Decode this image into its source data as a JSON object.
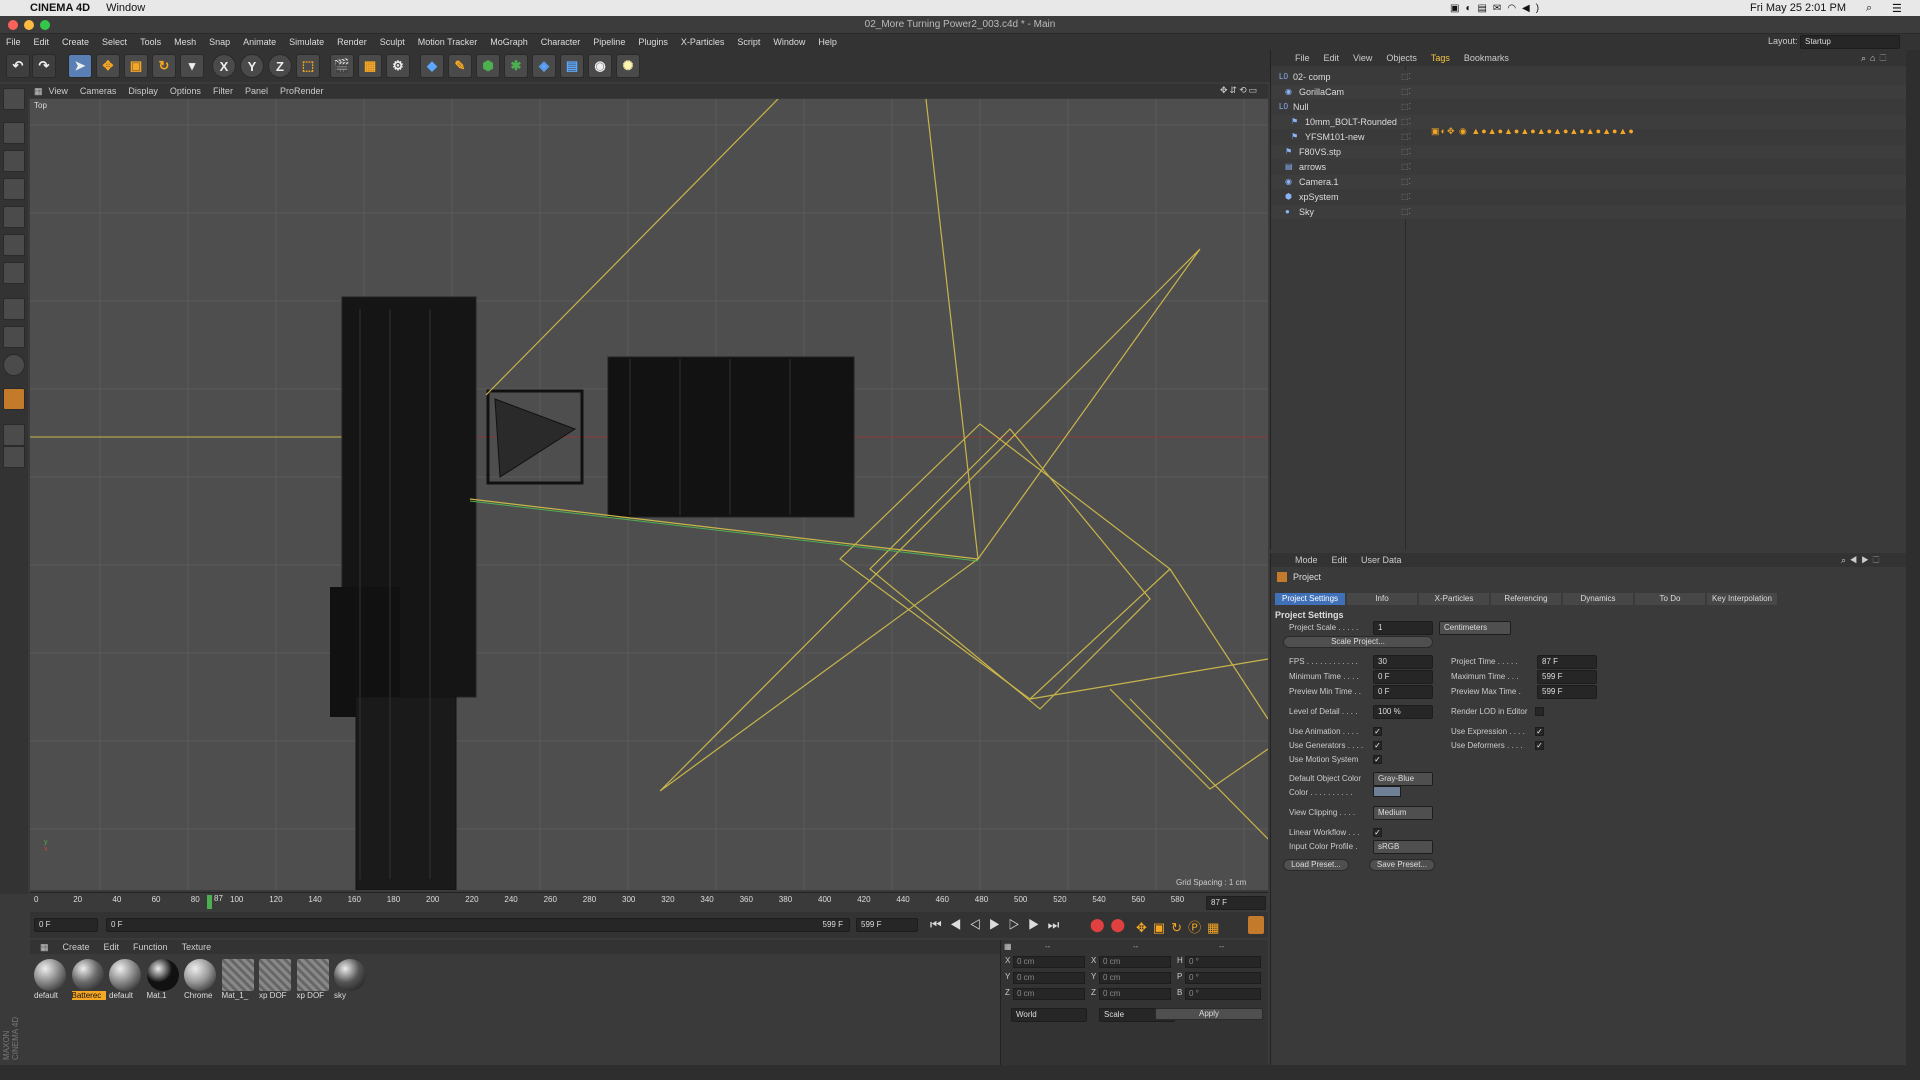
{
  "mac": {
    "app_name": "CINEMA 4D",
    "menu_window": "Window",
    "clock": "Fri May 25  2:01 PM"
  },
  "window": {
    "title": "02_More Turning Power2_003.c4d * - Main"
  },
  "menu": [
    "File",
    "Edit",
    "Create",
    "Select",
    "Tools",
    "Mesh",
    "Snap",
    "Animate",
    "Simulate",
    "Render",
    "Sculpt",
    "Motion Tracker",
    "MoGraph",
    "Character",
    "Pipeline",
    "Plugins",
    "X-Particles",
    "Script",
    "Window",
    "Help"
  ],
  "layout": {
    "label": "Layout:",
    "value": "Startup"
  },
  "toolbar": {
    "x": "X",
    "y": "Y",
    "z": "Z"
  },
  "viewport": {
    "menu": [
      "View",
      "Cameras",
      "Display",
      "Options",
      "Filter",
      "Panel",
      "ProRender"
    ],
    "name": "Top",
    "grid_spacing": "Grid Spacing : 1 cm"
  },
  "timeline": {
    "ticks": [
      "0",
      "20",
      "40",
      "60",
      "80",
      "100",
      "120",
      "140",
      "160",
      "180",
      "200",
      "220",
      "240",
      "260",
      "280",
      "300",
      "320",
      "340",
      "360",
      "380",
      "400",
      "420",
      "440",
      "460",
      "480",
      "500",
      "520",
      "540",
      "560",
      "580",
      "60"
    ],
    "playhead": "87",
    "current_frame": "87 F",
    "start": "0 F",
    "range_start": "0 F",
    "range_end": "599 F",
    "end": "599 F"
  },
  "materials": {
    "menu": [
      "Create",
      "Edit",
      "Function",
      "Texture"
    ],
    "items": [
      {
        "name": "default",
        "color": "#8a8a8a"
      },
      {
        "name": "Batterec",
        "color": "#6a6a6a"
      },
      {
        "name": "default",
        "color": "#8a8a8a"
      },
      {
        "name": "Mat.1",
        "color": "#111111"
      },
      {
        "name": "Chrome",
        "color": "#9a9a9a"
      },
      {
        "name": "Mat_1_",
        "color": "#7a7a7a"
      },
      {
        "name": "xp DOF",
        "color": "#777777"
      },
      {
        "name": "xp DOF",
        "color": "#777777"
      },
      {
        "name": "sky",
        "color": "#555555"
      }
    ]
  },
  "coords": {
    "headers": [
      "--",
      "--",
      "--"
    ],
    "rows": [
      {
        "a": "X",
        "av": "0 cm",
        "b": "X",
        "bv": "0 cm",
        "c": "H",
        "cv": "0 °"
      },
      {
        "a": "Y",
        "av": "0 cm",
        "b": "Y",
        "bv": "0 cm",
        "c": "P",
        "cv": "0 °"
      },
      {
        "a": "Z",
        "av": "0 cm",
        "b": "Z",
        "bv": "0 cm",
        "c": "B",
        "cv": "0 °"
      }
    ],
    "world": "World",
    "scale": "Scale",
    "apply": "Apply"
  },
  "objects": {
    "menu": [
      "File",
      "Edit",
      "View",
      "Objects",
      "Tags",
      "Bookmarks"
    ],
    "items": [
      {
        "name": "02- comp",
        "indent": 0
      },
      {
        "name": "GorillaCam",
        "indent": 1
      },
      {
        "name": "Null",
        "indent": 0
      },
      {
        "name": "10mm_BOLT-Rounded",
        "indent": 2
      },
      {
        "name": "YFSM101-new",
        "indent": 2
      },
      {
        "name": "F80VS.stp",
        "indent": 1
      },
      {
        "name": "arrows",
        "indent": 1
      },
      {
        "name": "Camera.1",
        "indent": 1
      },
      {
        "name": "xpSystem",
        "indent": 1
      },
      {
        "name": "Sky",
        "indent": 1
      }
    ]
  },
  "attributes": {
    "menu": [
      "Mode",
      "Edit",
      "User Data"
    ],
    "object": "Project",
    "tabs": [
      "Project Settings",
      "Info",
      "X-Particles",
      "Referencing",
      "Dynamics",
      "To Do",
      "Key Interpolation"
    ],
    "section": "Project Settings",
    "project_scale_label": "Project Scale . . . . .",
    "project_scale": "1",
    "project_scale_unit": "Centimeters",
    "scale_project_btn": "Scale Project...",
    "fps_label": "FPS . . . . . . . . . . . .",
    "fps": "30",
    "project_time_label": "Project Time . . . . .",
    "project_time": "87 F",
    "min_time_label": "Minimum Time . . . .",
    "min_time": "0 F",
    "max_time_label": "Maximum Time . . .",
    "max_time": "599 F",
    "prev_min_label": "Preview Min Time . .",
    "prev_min": "0 F",
    "prev_max_label": "Preview Max Time .",
    "prev_max": "599 F",
    "lod_label": "Level of Detail . . . .",
    "lod": "100 %",
    "render_lod_label": "Render LOD in Editor",
    "use_anim": "Use Animation . . . .",
    "use_expr": "Use Expression . . . .",
    "use_gen": "Use Generators . . . .",
    "use_def": "Use Deformers . . . .",
    "use_motion": "Use Motion System",
    "def_color_label": "Default Object Color",
    "def_color": "Gray-Blue",
    "color_label": "Color . . . . . . . . . .",
    "view_clip_label": "View Clipping . . . .",
    "view_clip": "Medium",
    "linear_label": "Linear Workflow . . .",
    "input_profile_label": "Input Color Profile .",
    "input_profile": "sRGB",
    "load_preset": "Load Preset...",
    "save_preset": "Save Preset..."
  },
  "brand": "MAXON CINEMA 4D",
  "colors": {
    "accent": "#3f70b8",
    "wire_yellow": "#c9b54a",
    "highlight": "#f5c542"
  }
}
